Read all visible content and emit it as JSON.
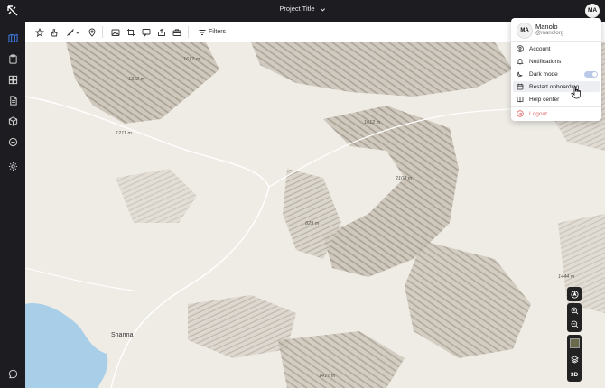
{
  "header": {
    "project_title": "Project Title"
  },
  "avatar_initials": "MA",
  "toolbar": {
    "filters_label": "Filters"
  },
  "user_menu": {
    "name": "Manolo",
    "handle": "@manolorg",
    "items": [
      {
        "label": "Account",
        "icon": "user-circle-icon"
      },
      {
        "label": "Notifications",
        "icon": "bell-icon"
      },
      {
        "label": "Dark mode",
        "icon": "moon-icon",
        "toggle": true
      },
      {
        "label": "Restart onboarding",
        "icon": "calendar-icon",
        "hovered": true
      },
      {
        "label": "Help center",
        "icon": "book-icon"
      }
    ],
    "logout_label": "Logout"
  },
  "map": {
    "elevations": [
      "1612 m",
      "2108 m",
      "829 m",
      "1444 m",
      "1617 m",
      "1312 m",
      "1211 m",
      "1417 m"
    ],
    "place_name": "Sharma",
    "controls": {
      "view_3d_label": "3D"
    }
  },
  "colors": {
    "accent": "#3d7be8",
    "logout": "#e36b6b",
    "chrome": "#1d1d21",
    "water": "#a9cfe8"
  }
}
